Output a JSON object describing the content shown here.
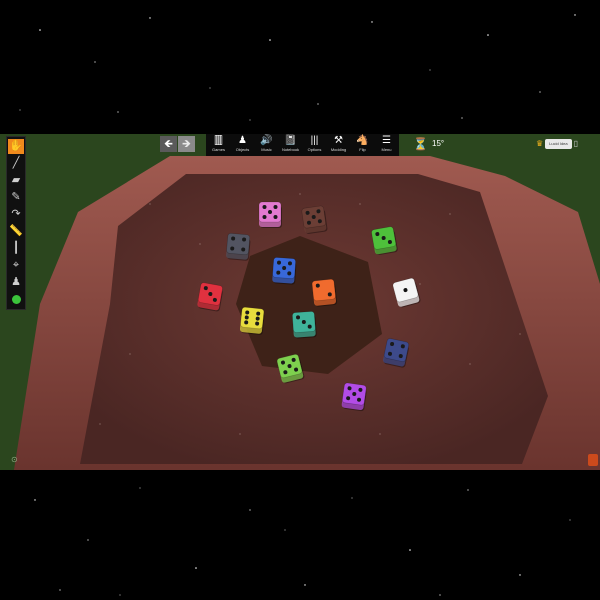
{
  "window": {
    "background": "#000000"
  },
  "left_toolbar": {
    "tools": [
      {
        "name": "grab-tool",
        "icon": "hand",
        "glyph": "✋",
        "active": true
      },
      {
        "name": "line-tool",
        "icon": "line",
        "glyph": "╱"
      },
      {
        "name": "shape-tool",
        "icon": "shape",
        "glyph": "▰"
      },
      {
        "name": "draw-tool",
        "icon": "pen",
        "glyph": "✎"
      },
      {
        "name": "flick-tool",
        "icon": "flick",
        "glyph": "↷"
      },
      {
        "name": "measure-tool",
        "icon": "ruler",
        "glyph": "📏"
      },
      {
        "name": "pointer-tool",
        "icon": "pointer",
        "glyph": "┃"
      },
      {
        "name": "gizmo-tool",
        "icon": "gizmo",
        "glyph": "⌖"
      },
      {
        "name": "color-tool",
        "icon": "color-marker",
        "glyph": "♟"
      },
      {
        "name": "player-color",
        "icon": "green-dot",
        "glyph": ""
      }
    ]
  },
  "undo_redo": {
    "undo_glyph": "🡸",
    "redo_glyph": "🡺"
  },
  "top_toolbar": {
    "buttons": [
      {
        "label": "Games",
        "glyph": "🀫",
        "icon": "games-icon"
      },
      {
        "label": "Objects",
        "glyph": "♟",
        "icon": "objects-icon"
      },
      {
        "label": "Music",
        "glyph": "🔊",
        "icon": "music-icon"
      },
      {
        "label": "Notebook",
        "glyph": "📓",
        "icon": "notebook-icon"
      },
      {
        "label": "Options",
        "glyph": "|||",
        "icon": "options-icon"
      },
      {
        "label": "Modding",
        "glyph": "⚒",
        "icon": "modding-icon"
      },
      {
        "label": "Flip",
        "glyph": "🐴",
        "icon": "flip-icon"
      },
      {
        "label": "Menu",
        "glyph": "☰",
        "icon": "menu-icon"
      }
    ]
  },
  "ruler_glyph": "⏳",
  "angle": "15°",
  "player": {
    "crown_glyph": "♛",
    "name": "Lucid Idea",
    "menu_glyph": "▯"
  },
  "bottom_left_glyph": "⊙",
  "colors": {
    "table_rim": "#7a4038",
    "table_felt": "#5b2f2c",
    "center_hex": "#3e2218",
    "grass": "#2f4a22",
    "accent": "#f08a1c"
  },
  "dice": [
    {
      "name": "pink",
      "color": "#e37ad0",
      "pips": 5
    },
    {
      "name": "dark-brown",
      "color": "#6b3e35",
      "pips": 5
    },
    {
      "name": "gray",
      "color": "#525461",
      "pips": 4
    },
    {
      "name": "green",
      "color": "#4ec03b",
      "pips": 3
    },
    {
      "name": "blue",
      "color": "#3868d9",
      "pips": 5
    },
    {
      "name": "orange",
      "color": "#f06b2e",
      "pips": 2
    },
    {
      "name": "red",
      "color": "#e0313f",
      "pips": 3
    },
    {
      "name": "white",
      "color": "#f4f4f4",
      "pips": 1
    },
    {
      "name": "yellow",
      "color": "#e8dd3d",
      "pips": 6
    },
    {
      "name": "teal",
      "color": "#3fb39a",
      "pips": 3
    },
    {
      "name": "navy",
      "color": "#3d4a8a",
      "pips": 4
    },
    {
      "name": "lime",
      "color": "#7ed04e",
      "pips": 5
    },
    {
      "name": "purple",
      "color": "#b24ce6",
      "pips": 5
    }
  ]
}
